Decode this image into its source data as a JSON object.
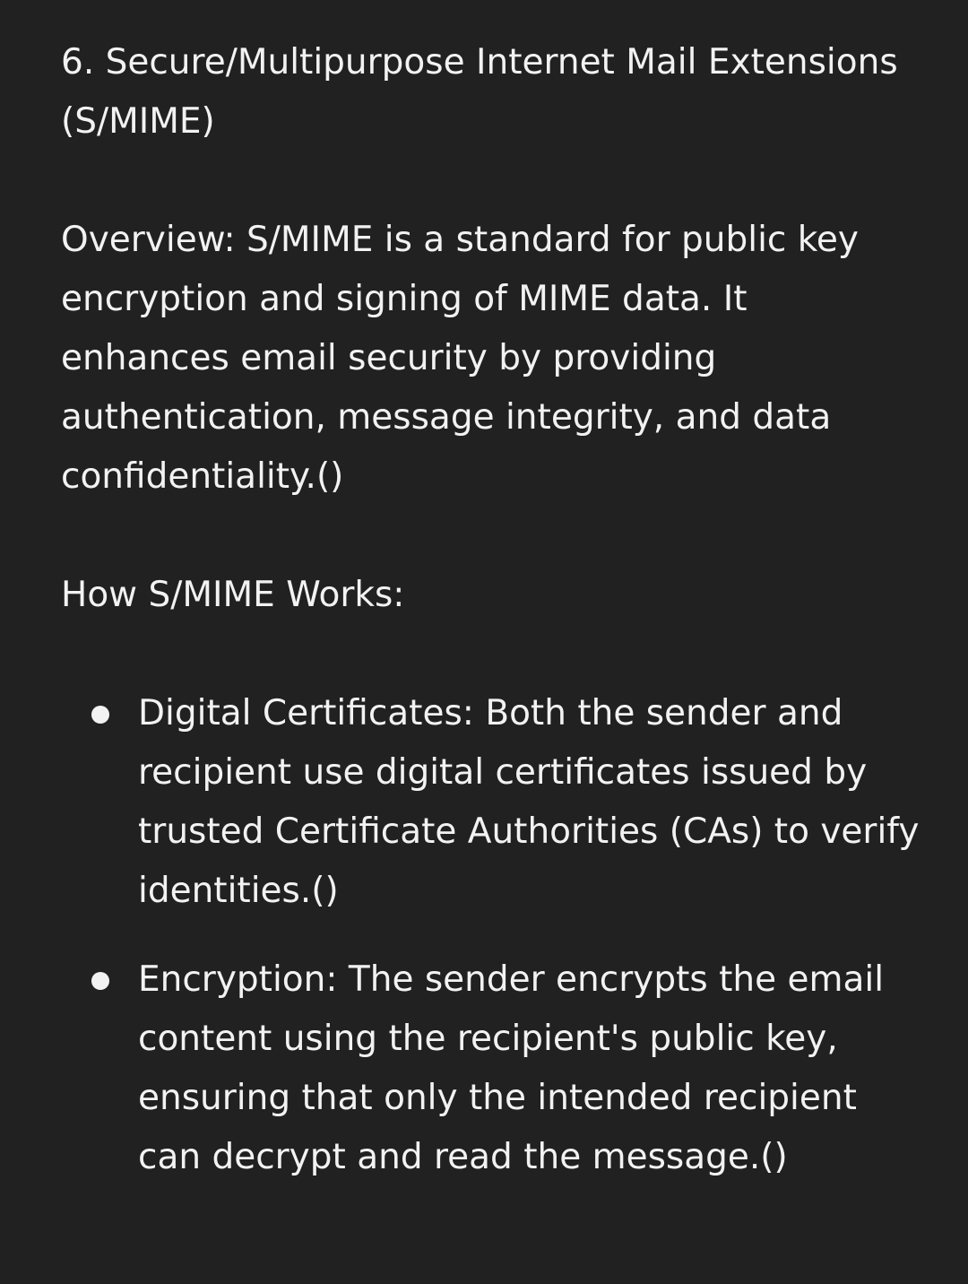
{
  "heading": "6. Secure/Multipurpose Internet Mail Extensions (S/MIME)",
  "overview": "Overview: S/MIME is a standard for public key encryption and signing of MIME data. It enhances email security by providing authentication, message integrity, and data confidentiality.()",
  "subheading": "How S/MIME Works:",
  "items": [
    {
      "text": "Digital Certificates: Both the sender and recipient use digital certificates issued by trusted Certificate Authorities (CAs) to verify identities.()"
    },
    {
      "text": "Encryption: The sender encrypts the email content using the recipient's public key, ensuring that only the intended recipient can decrypt and read the message.()"
    }
  ]
}
